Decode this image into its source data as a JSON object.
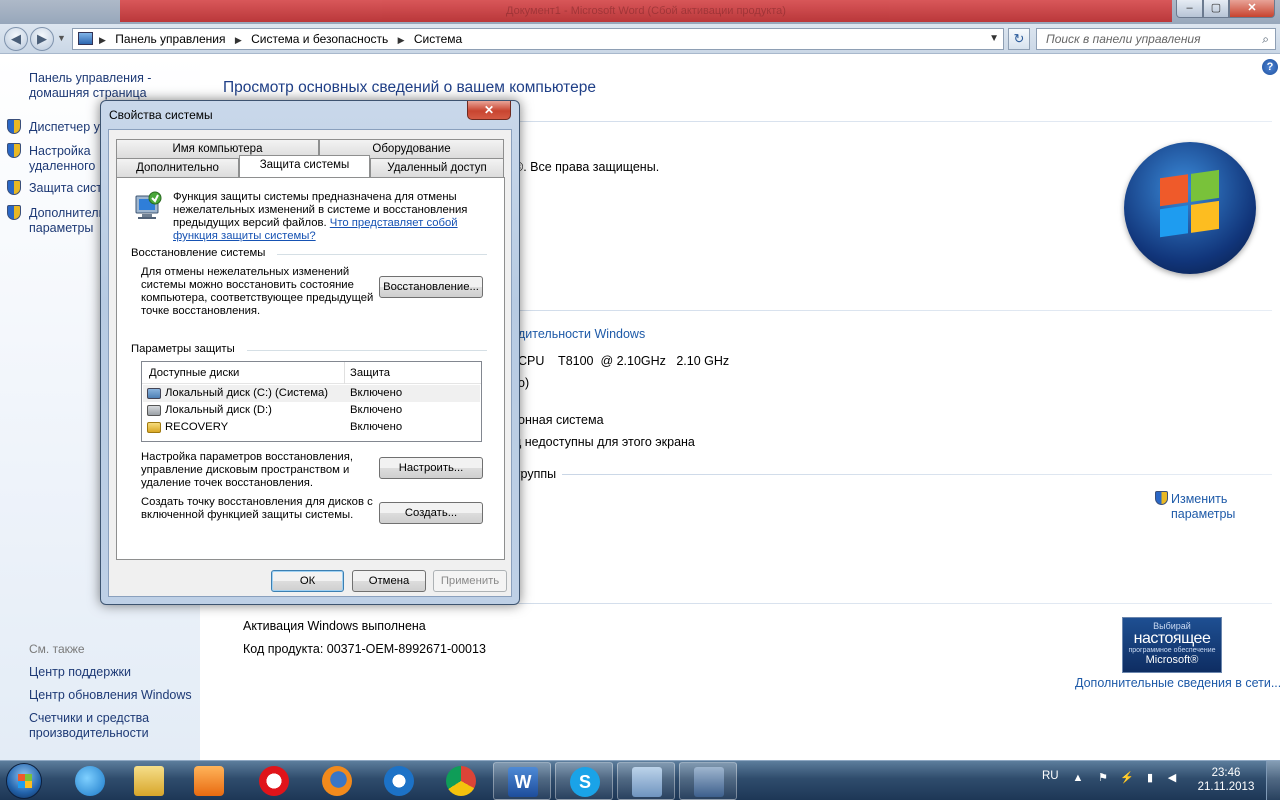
{
  "window": {
    "title": "Документ1 - Microsoft Word (Сбой активации продукта)",
    "controls": {
      "minimize": "–",
      "maximize": "▢",
      "close": "✕"
    }
  },
  "address": {
    "breadcrumbs": [
      "Панель управления",
      "Система и безопасность",
      "Система"
    ],
    "search_placeholder": "Поиск в панели управления"
  },
  "sidebar": {
    "home_link": "Панель управления - домашняя страница",
    "links": [
      "Диспетчер устройств",
      "Настройка удаленного доступа",
      "Защита системы",
      "Дополнительные параметры системы"
    ],
    "see_also_title": "См. также",
    "see_also": [
      "Центр поддержки",
      "Центр обновления Windows",
      "Счетчики и средства производительности"
    ]
  },
  "main": {
    "title": "Просмотр основных сведений о вашем компьютере",
    "edition_copyright": "©. Все права защищены.",
    "perf_link": "дительности Windows",
    "cpu": "CPU    T8100  @ 2.10GHz   2.10 GHz",
    "ram": "о)",
    "os_type": "онная система",
    "pen": "д недоступны для этого экрана",
    "workgroup": "группы",
    "change_settings": "Изменить параметры",
    "activation_status": "Активация Windows выполнена",
    "product_key": "Код продукта:  00371-OEM-8992671-00013",
    "more_info_link": "Дополнительные сведения в сети...",
    "genuine_badge": {
      "line1": "Выбирай",
      "line2": "настоящее",
      "line3": "программное обеспечение",
      "line4": "Microsoft®"
    }
  },
  "dialog": {
    "title": "Свойства системы",
    "tabs_row1": [
      "Имя компьютера",
      "Оборудование"
    ],
    "tabs_row2": [
      "Дополнительно",
      "Защита системы",
      "Удаленный доступ"
    ],
    "active_tab": "Защита системы",
    "intro_text": "Функция защиты системы предназначена для отмены нежелательных изменений в системе и восстановления предыдущих версий файлов.",
    "intro_link": "Что представляет собой функция защиты системы?",
    "restore_group": "Восстановление системы",
    "restore_text": "Для отмены нежелательных изменений системы можно восстановить состояние компьютера, соответствующее предыдущей точке восстановления.",
    "restore_button": "Восстановление...",
    "protection_group": "Параметры защиты",
    "columns": [
      "Доступные диски",
      "Защита"
    ],
    "drives": [
      {
        "name": "Локальный диск (C:) (Система)",
        "state": "Включено"
      },
      {
        "name": "Локальный диск (D:)",
        "state": "Включено"
      },
      {
        "name": "RECOVERY",
        "state": "Включено"
      }
    ],
    "configure_text": "Настройка параметров восстановления, управление дисковым пространством и удаление точек восстановления.",
    "configure_button": "Настроить...",
    "create_text": "Создать точку восстановления для дисков с включенной функцией защиты системы.",
    "create_button": "Создать...",
    "ok": "ОК",
    "cancel": "Отмена",
    "apply": "Применить"
  },
  "taskbar": {
    "apps": [
      "Internet Explorer",
      "Проводник",
      "Медиаплеер",
      "Opera",
      "Firefox",
      "Почта",
      "Chrome",
      "Microsoft Word",
      "Skype",
      "Панель управления",
      "Свойства системы"
    ],
    "language": "RU",
    "time": "23:46",
    "date": "21.11.2013"
  },
  "colors": {
    "link": "#1e3a76",
    "title": "#1f3f87",
    "taskbar": "#2f4c6c"
  }
}
